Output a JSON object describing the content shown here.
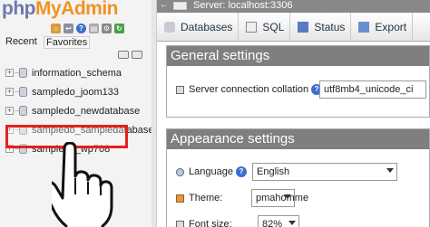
{
  "nav": {
    "logo": {
      "php": "php",
      "myadmin": "MyAdmin"
    },
    "tabs": {
      "recent": "Recent",
      "favorites": "Favorites"
    },
    "databases": [
      "information_schema",
      "sampledo_joom133",
      "sampledo_newdatabase",
      "sampledo_sampledatabase",
      "sampledo_wp708"
    ]
  },
  "server": {
    "label": "Server: localhost:3306"
  },
  "toptabs": [
    {
      "label": "Databases"
    },
    {
      "label": "SQL"
    },
    {
      "label": "Status"
    },
    {
      "label": "Export"
    }
  ],
  "general": {
    "title": "General settings",
    "collation_label": "Server connection collation",
    "collation_value": "utf8mb4_unicode_ci"
  },
  "appearance": {
    "title": "Appearance settings",
    "language_label": "Language",
    "language_value": "English",
    "theme_label": "Theme:",
    "theme_value": "pmahomme",
    "fontsize_label": "Font size:",
    "fontsize_value": "82%"
  },
  "colors": {
    "highlight": "#e3211c",
    "header": "#7f7f7f",
    "logo_blue": "#6c78af",
    "logo_orange": "#f29220"
  }
}
